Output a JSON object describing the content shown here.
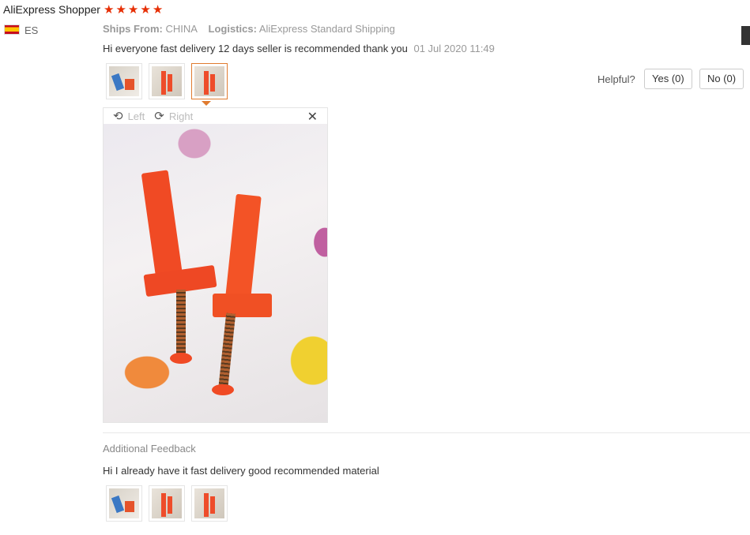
{
  "reviewer": {
    "name": "AliExpress Shopper",
    "rating": 5,
    "country": "ES"
  },
  "meta": {
    "ships_from_label": "Ships From:",
    "ships_from_value": "CHINA",
    "logistics_label": "Logistics:",
    "logistics_value": "AliExpress Standard Shipping"
  },
  "review": {
    "text": "Hi everyone fast delivery 12 days seller is recommended thank you",
    "date": "01 Jul 2020 11:49"
  },
  "helpful": {
    "label": "Helpful?",
    "yes": "Yes (0)",
    "no": "No (0)"
  },
  "viewer": {
    "left_label": "Left",
    "right_label": "Right",
    "close_glyph": "✕",
    "left_glyph": "⟲",
    "right_glyph": "⟳"
  },
  "additional": {
    "heading": "Additional Feedback",
    "text": "Hi I already have it fast delivery good recommended material"
  },
  "colors": {
    "star": "#e62e04",
    "active_thumb": "#e07b2f"
  }
}
